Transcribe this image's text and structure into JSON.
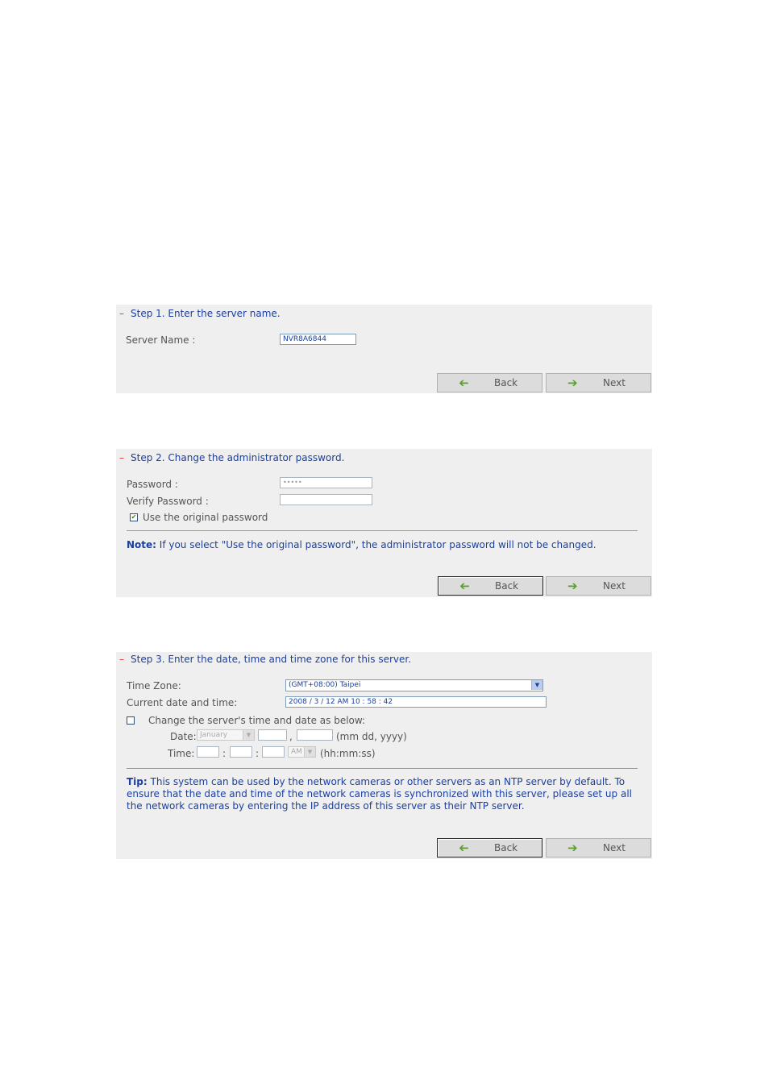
{
  "step1": {
    "dash": "–",
    "title": "Step 1. Enter the server name.",
    "server_name_label": "Server Name :",
    "server_name_value": "NVR8A6844",
    "back_label": "Back",
    "next_label": "Next"
  },
  "step2": {
    "dash": "–",
    "title": "Step 2. Change the administrator password.",
    "password_label": "Password :",
    "password_value": "•••••",
    "verify_label": "Verify Password :",
    "verify_value": "",
    "use_original_label": "Use the original password",
    "use_original_checked": true,
    "note_prefix": "Note:",
    "note_text": " If you select \"Use the original password\", the administrator password will not be changed.",
    "back_label": "Back",
    "next_label": "Next"
  },
  "step3": {
    "dash": "–",
    "title": "Step 3. Enter the date, time and time zone for this server.",
    "time_zone_label": "Time Zone:",
    "time_zone_value": "(GMT+08:00) Taipei",
    "current_label": "Current date and time:",
    "current_value": "2008 / 3 / 12 AM 10 : 58 : 42",
    "change_label": "Change the server's time and date as below:",
    "change_checked": false,
    "date_label": "Date:",
    "month_value": "January",
    "date_sep": ",",
    "date_format": "(mm dd, yyyy)",
    "time_label": "Time:",
    "time_sep1": ":",
    "time_sep2": ":",
    "ampm_value": "AM",
    "time_format": "(hh:mm:ss)",
    "tip_prefix": "Tip:",
    "tip_text": " This system can be used by the network cameras or other servers as an NTP server by default. To ensure that the date and time of the network cameras is synchronized with this server, please set up all the network cameras by entering the IP address of this server as their NTP server.",
    "back_label": "Back",
    "next_label": "Next"
  },
  "icons": {
    "back": "arrow-left-icon",
    "next": "arrow-right-icon",
    "dropdown": "chevron-down-icon",
    "check": "checkmark-icon"
  },
  "colors": {
    "panel_bg": "#efefef",
    "title_blue": "#1a3fa0",
    "dash_red": "#e03030",
    "arrow_green": "#5aa02a"
  }
}
